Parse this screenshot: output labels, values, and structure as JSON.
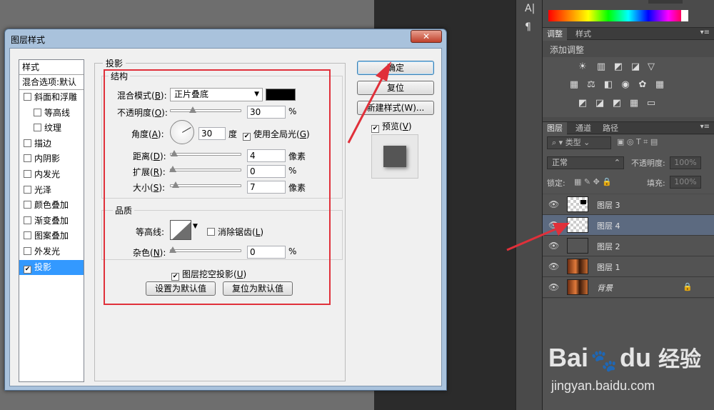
{
  "dialog": {
    "title": "图层样式",
    "close": "✕",
    "styles_header": "样式",
    "blend_options": "混合选项:默认",
    "styles": [
      {
        "label": "斜面和浮雕",
        "checked": false,
        "indent": false
      },
      {
        "label": "等高线",
        "checked": false,
        "indent": true
      },
      {
        "label": "纹理",
        "checked": false,
        "indent": true
      },
      {
        "label": "描边",
        "checked": false,
        "indent": false
      },
      {
        "label": "内阴影",
        "checked": false,
        "indent": false
      },
      {
        "label": "内发光",
        "checked": false,
        "indent": false
      },
      {
        "label": "光泽",
        "checked": false,
        "indent": false
      },
      {
        "label": "颜色叠加",
        "checked": false,
        "indent": false
      },
      {
        "label": "渐变叠加",
        "checked": false,
        "indent": false
      },
      {
        "label": "图案叠加",
        "checked": false,
        "indent": false
      },
      {
        "label": "外发光",
        "checked": false,
        "indent": false
      },
      {
        "label": "投影",
        "checked": true,
        "indent": false
      }
    ],
    "section_title": "投影",
    "structure": {
      "title": "结构",
      "blend_mode_label": "混合模式(",
      "blend_mode_key": "B",
      "blend_mode_value": "正片叠底",
      "color": "#000000",
      "opacity_label": "不透明度(",
      "opacity_key": "O",
      "opacity_value": "30",
      "opacity_unit": "%",
      "angle_label": "角度(",
      "angle_key": "A",
      "angle_value": "30",
      "angle_unit": "度",
      "global_light_label": "使用全局光(",
      "global_light_key": "G",
      "distance_label": "距离(",
      "distance_key": "D",
      "distance_value": "4",
      "distance_unit": "像素",
      "spread_label": "扩展(",
      "spread_key": "R",
      "spread_value": "0",
      "spread_unit": "%",
      "size_label": "大小(",
      "size_key": "S",
      "size_value": "7",
      "size_unit": "像素"
    },
    "quality": {
      "title": "品质",
      "contour_label": "等高线:",
      "anti_alias_label": "消除锯齿(",
      "anti_alias_key": "L",
      "noise_label": "杂色(",
      "noise_key": "N",
      "noise_value": "0",
      "noise_unit": "%"
    },
    "knockout_label": "图层挖空投影(",
    "knockout_key": "U",
    "set_default": "设置为默认值",
    "reset_default": "复位为默认值",
    "ok": "确定",
    "reset": "复位",
    "new_style": "新建样式(W)...",
    "preview_label": "预览(",
    "preview_key": "V"
  },
  "panels": {
    "adjust_tabs": [
      "调整",
      "样式"
    ],
    "adjust_hint": "添加调整",
    "layers_tabs": [
      "图层",
      "通道",
      "路径"
    ],
    "filter_kind": "类型",
    "blend_mode": "正常",
    "opacity_label": "不透明度:",
    "opacity_value": "100%",
    "lock_label": "锁定:",
    "fill_label": "填充:",
    "fill_value": "100%",
    "layers": [
      {
        "name": "图层 3",
        "selected": false
      },
      {
        "name": "图层 4",
        "selected": true
      },
      {
        "name": "图层 2",
        "selected": false
      },
      {
        "name": "图层 1",
        "selected": false
      },
      {
        "name": "背景",
        "selected": false
      }
    ]
  },
  "toolstrip": [
    "A|",
    "¶"
  ],
  "watermark": {
    "brand_left": "Bai",
    "brand_right": "du",
    "brand_cn": "经验",
    "url": "jingyan.baidu.com"
  },
  "colors": {
    "accent_red": "#e0303a",
    "selection": "#3399ff"
  }
}
